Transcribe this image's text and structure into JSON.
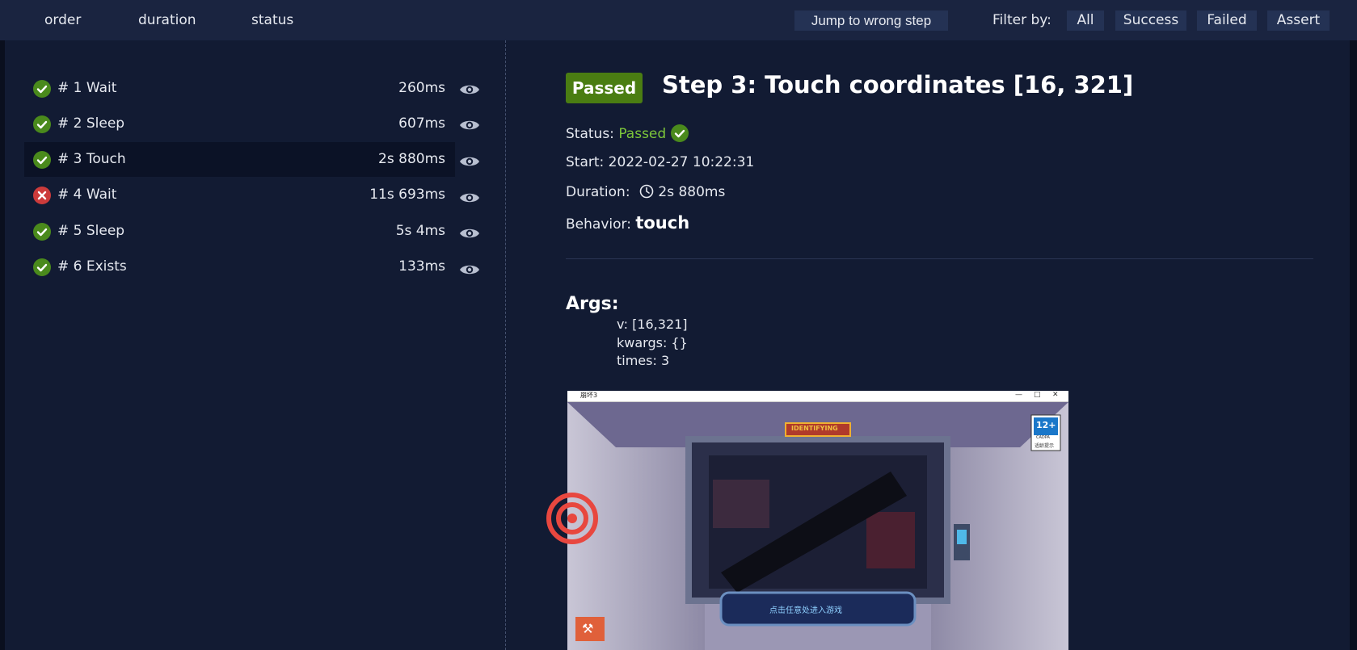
{
  "toolbar": {
    "sort": {
      "order": "order",
      "duration": "duration",
      "status": "status"
    },
    "jump_label": "Jump to wrong step",
    "filter_label": "Filter by:",
    "filters": {
      "all": "All",
      "success": "Success",
      "failed": "Failed",
      "assert": "Assert"
    }
  },
  "steps": [
    {
      "label": "# 1 Wait",
      "duration": "260ms",
      "status": "success"
    },
    {
      "label": "# 2 Sleep",
      "duration": "607ms",
      "status": "success"
    },
    {
      "label": "# 3 Touch",
      "duration": "2s 880ms",
      "status": "success"
    },
    {
      "label": "# 4 Wait",
      "duration": "11s 693ms",
      "status": "failed"
    },
    {
      "label": "# 5 Sleep",
      "duration": "5s 4ms",
      "status": "success"
    },
    {
      "label": "# 6 Exists",
      "duration": "133ms",
      "status": "success"
    }
  ],
  "detail": {
    "badge": "Passed",
    "title": "Step 3: Touch coordinates [16, 321]",
    "status_label": "Status:",
    "status_value": "Passed",
    "start_label": "Start:",
    "start_value": "2022-02-27 10:22:31",
    "duration_label": "Duration:",
    "duration_value": "2s 880ms",
    "behavior_label": "Behavior:",
    "behavior_value": "touch",
    "args_title": "Args:",
    "args": {
      "v": "v: [16,321]",
      "kwargs": "kwargs: {}",
      "times": "times: 3"
    }
  },
  "screenshot": {
    "window_title": "崩坏3",
    "badge_age": "12+",
    "badge_org": "CADPA",
    "badge_note": "适龄提示",
    "banner_text": "IDENTIFYING",
    "prompt_text": "点击任意处进入游戏"
  },
  "colors": {
    "background": "#0a0f1e",
    "topbar": "#1a2440",
    "panel": "#121b33",
    "button": "#243254",
    "success": "#4a8a1c",
    "failed": "#cc3b3b",
    "passed_badge": "#4a7d12",
    "passed_text": "#7cc63a",
    "target": "#e8473f"
  },
  "icons": {
    "step_success": "check-circle-icon",
    "step_failed": "x-circle-icon",
    "preview": "eye-icon",
    "duration": "clock-icon",
    "touch_target": "target-icon"
  }
}
